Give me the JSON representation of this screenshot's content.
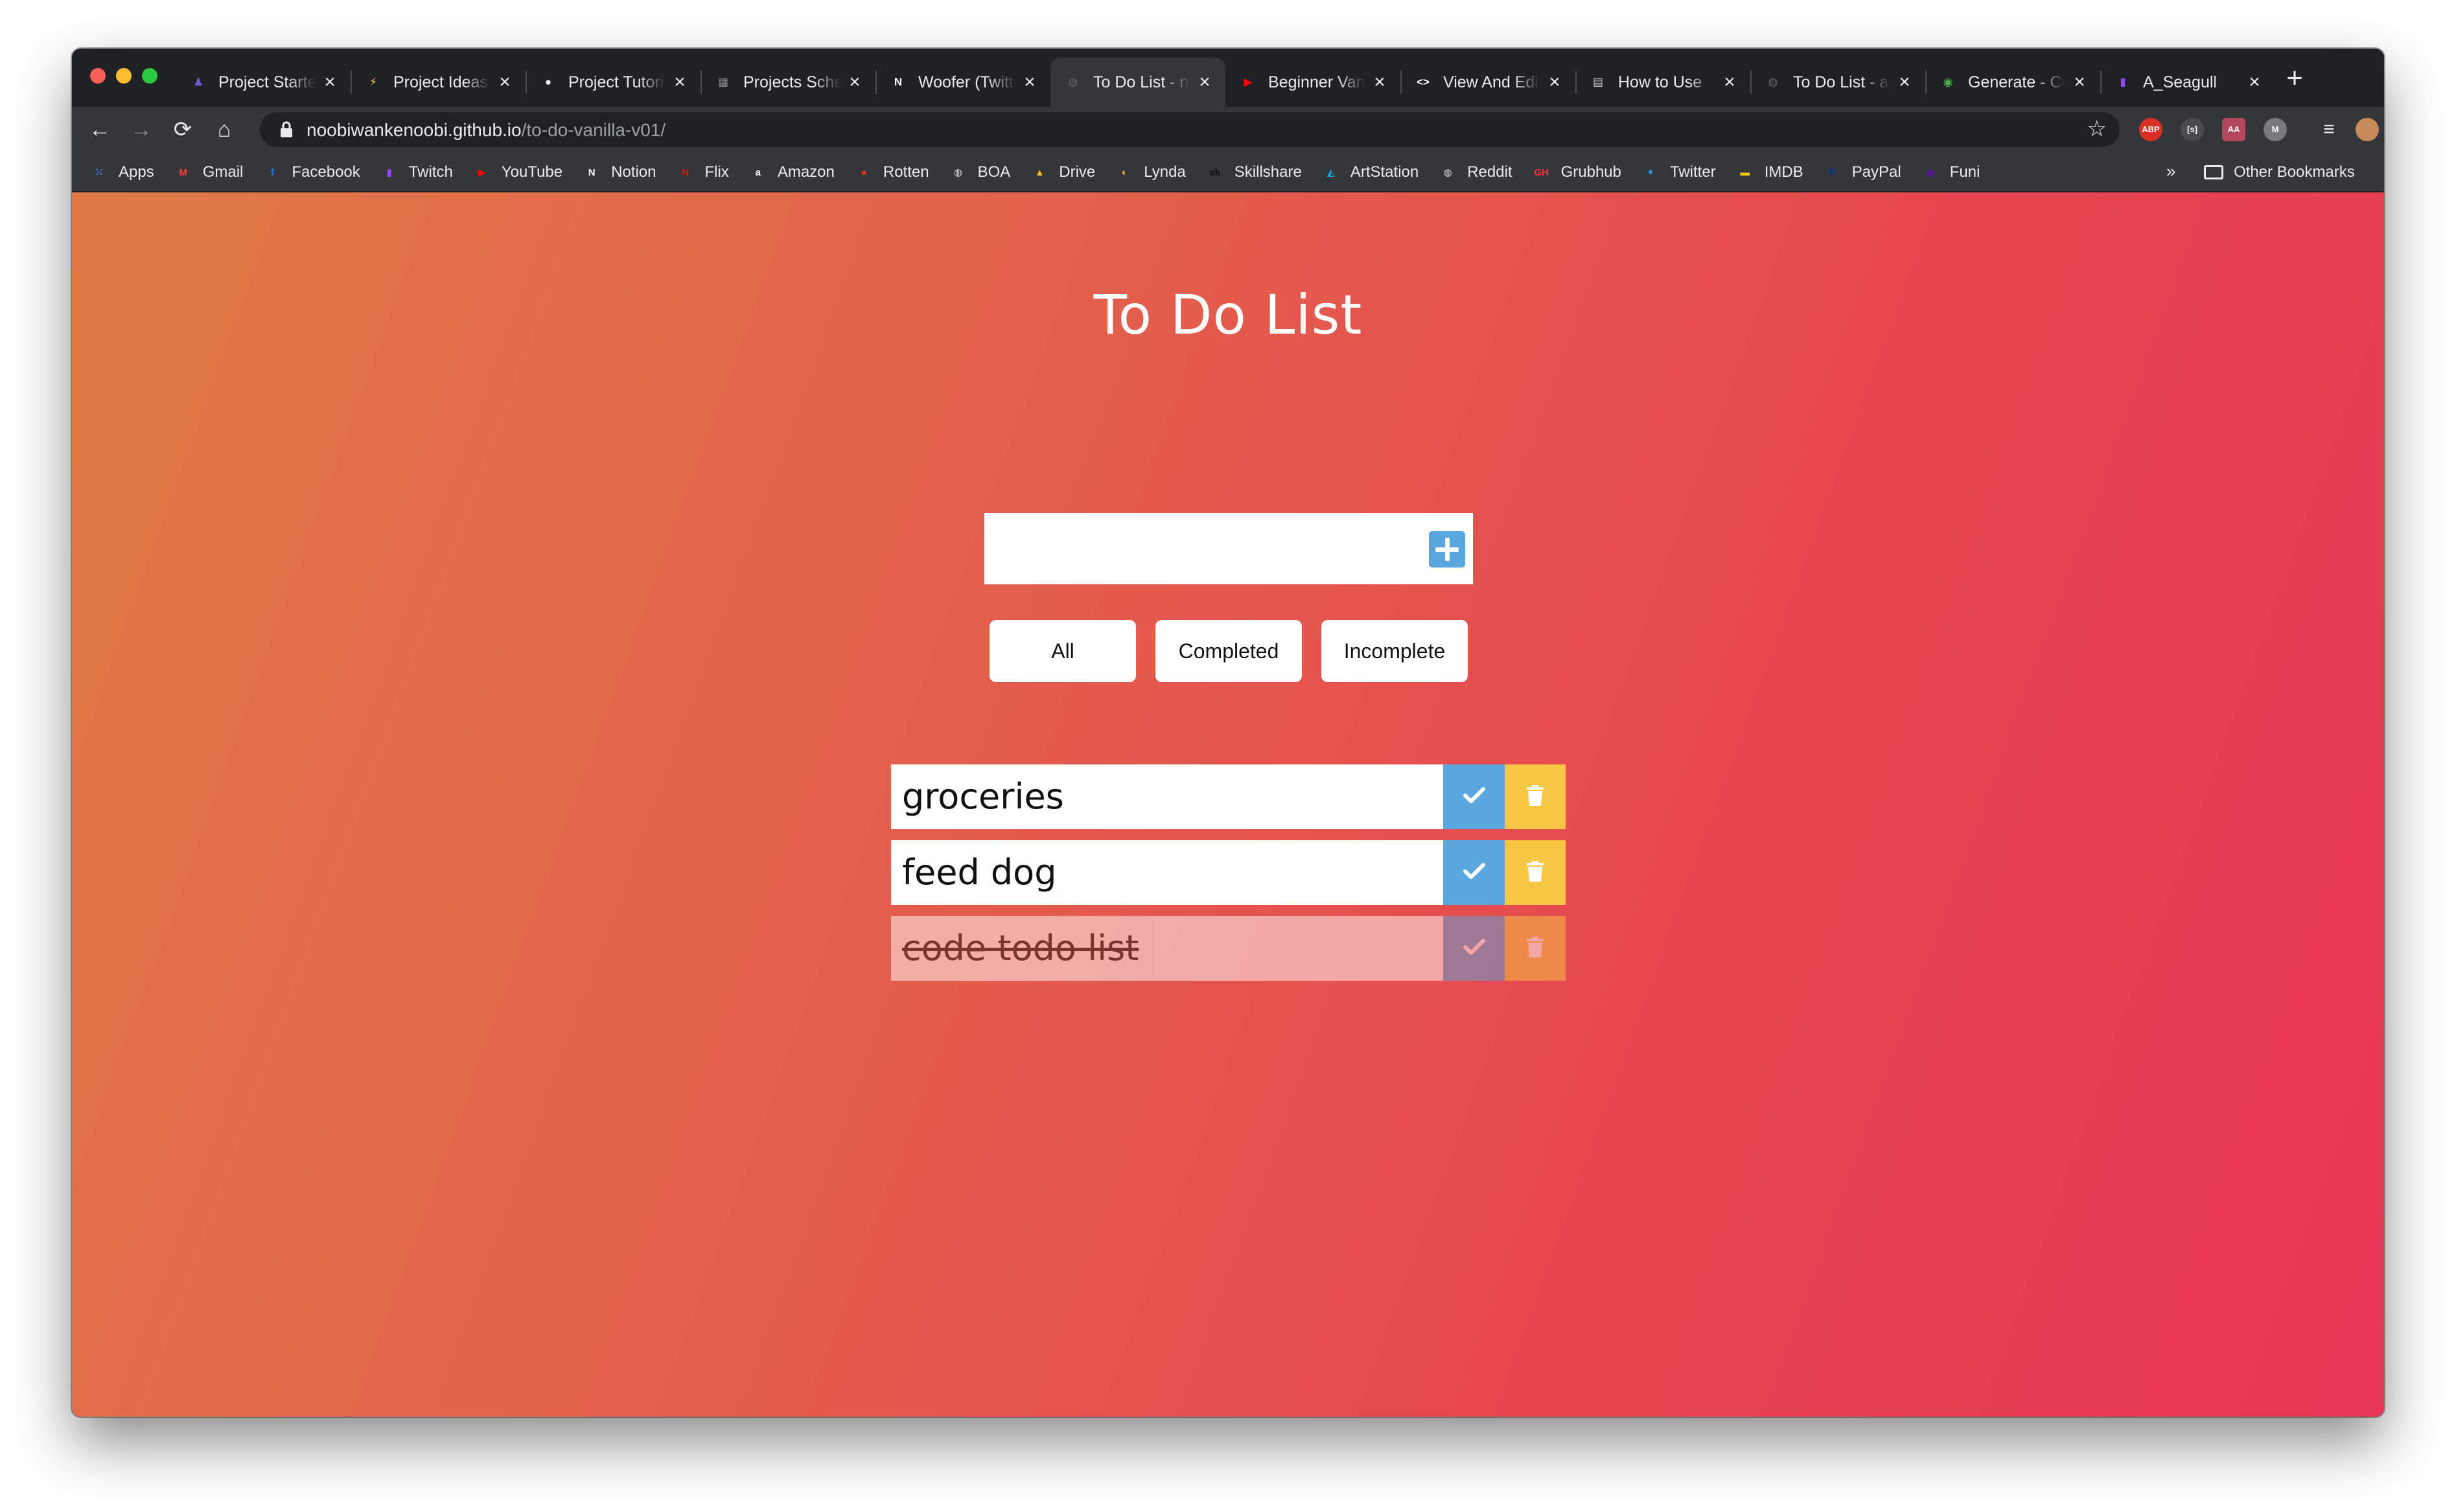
{
  "browser": {
    "tabs": [
      {
        "title": "Project Starter",
        "favicon": "project-icon",
        "color": "#6b5bd6",
        "active": false
      },
      {
        "title": "Project Ideas",
        "favicon": "lightning-icon",
        "color": "#f2c94c",
        "active": false
      },
      {
        "title": "Project Tutorials",
        "favicon": "lightbulb-icon",
        "color": "#f2f2f2",
        "active": false
      },
      {
        "title": "Projects Schedule",
        "favicon": "calendar-icon",
        "color": "#8a8a8a",
        "active": false
      },
      {
        "title": "Woofer (Twitter)",
        "favicon": "notion-icon",
        "color": "#ffffff",
        "active": false
      },
      {
        "title": "To Do List - noobiwankenoobi",
        "favicon": "globe-icon",
        "color": "#5f6368",
        "active": true
      },
      {
        "title": "Beginner Vanilla JS",
        "favicon": "youtube-icon",
        "color": "#ff0000",
        "active": false
      },
      {
        "title": "View And Edit",
        "favicon": "code-icon",
        "color": "#ffffff",
        "active": false
      },
      {
        "title": "How to Use",
        "favicon": "floppy-icon",
        "color": "#cccccc",
        "active": false
      },
      {
        "title": "To Do List - app",
        "favicon": "globe-icon",
        "color": "#5f6368",
        "active": false
      },
      {
        "title": "Generate - Color",
        "favicon": "chrome-icon",
        "color": "#4caf50",
        "active": false
      },
      {
        "title": "A_Seagull",
        "favicon": "twitch-icon",
        "color": "#9146ff",
        "active": false
      }
    ],
    "url_domain": "noobiwankenoobi.github.io",
    "url_path": "/to-do-vanilla-v01/",
    "extensions": [
      "ABP",
      "[s]",
      "AA",
      "M"
    ],
    "bookmarks": [
      {
        "label": "Apps",
        "icon": "apps-grid-icon",
        "color": "#4285f4"
      },
      {
        "label": "Gmail",
        "icon": "gmail-icon",
        "color": "#ea4335"
      },
      {
        "label": "Facebook",
        "icon": "facebook-icon",
        "color": "#1877f2"
      },
      {
        "label": "Twitch",
        "icon": "twitch-icon",
        "color": "#9146ff"
      },
      {
        "label": "YouTube",
        "icon": "youtube-icon",
        "color": "#ff0000"
      },
      {
        "label": "Notion",
        "icon": "notion-icon",
        "color": "#ffffff"
      },
      {
        "label": "Flix",
        "icon": "netflix-icon",
        "color": "#e50914"
      },
      {
        "label": "Amazon",
        "icon": "amazon-icon",
        "color": "#ffffff"
      },
      {
        "label": "Rotten",
        "icon": "tomato-icon",
        "color": "#fa320a"
      },
      {
        "label": "BOA",
        "icon": "globe-icon",
        "color": "#dadce0"
      },
      {
        "label": "Drive",
        "icon": "drive-icon",
        "color": "#fbbc04"
      },
      {
        "label": "Lynda",
        "icon": "lynda-icon",
        "color": "#ffc220"
      },
      {
        "label": "Skillshare",
        "icon": "skillshare-icon",
        "color": "#111111"
      },
      {
        "label": "ArtStation",
        "icon": "artstation-icon",
        "color": "#13aff0"
      },
      {
        "label": "Reddit",
        "icon": "globe-icon",
        "color": "#dadce0"
      },
      {
        "label": "Grubhub",
        "icon": "grubhub-icon",
        "color": "#f63440"
      },
      {
        "label": "Twitter",
        "icon": "twitter-icon",
        "color": "#1da1f2"
      },
      {
        "label": "IMDB",
        "icon": "imdb-icon",
        "color": "#f5c518"
      },
      {
        "label": "PayPal",
        "icon": "paypal-icon",
        "color": "#003087"
      },
      {
        "label": "Funi",
        "icon": "funimation-icon",
        "color": "#5b0bb5"
      }
    ],
    "bookmarks_overflow": "»",
    "other_bookmarks": "Other Bookmarks"
  },
  "app": {
    "title": "To Do List",
    "input_placeholder": "",
    "filters": [
      "All",
      "Completed",
      "Incomplete"
    ],
    "todos": [
      {
        "text": "groceries",
        "completed": false
      },
      {
        "text": "feed dog",
        "completed": false
      },
      {
        "text": "code todo list",
        "completed": true
      }
    ],
    "colors": {
      "check": "#5aa7df",
      "trash": "#f7c744",
      "gradient_start": "#e07a45",
      "gradient_end": "#e83657"
    }
  }
}
